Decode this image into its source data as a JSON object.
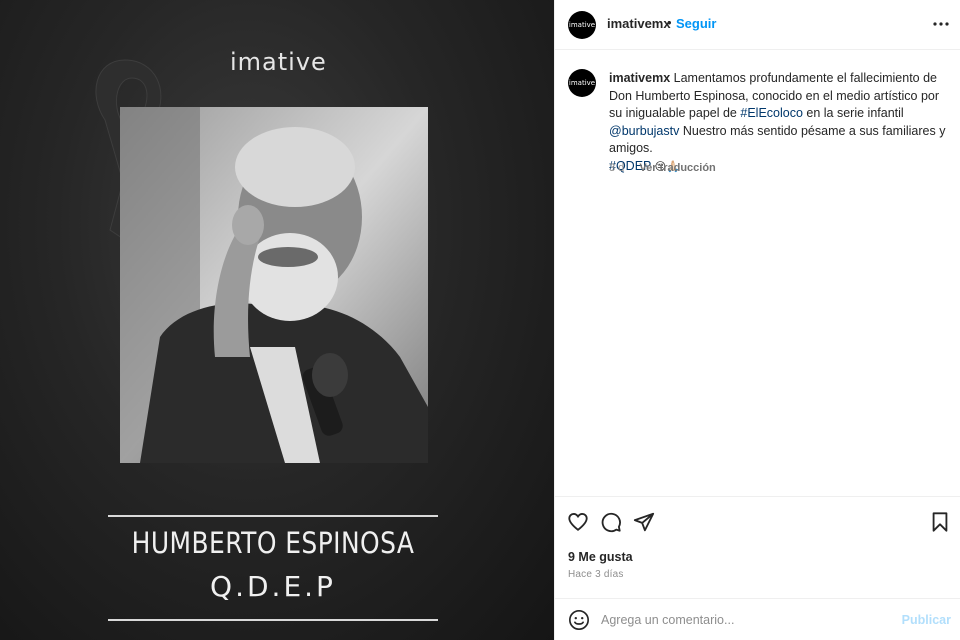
{
  "post_image": {
    "brand": "imative",
    "memorial_name": "HUMBERTO ESPINOSA",
    "memorial_rip": "Q.D.E.P"
  },
  "header": {
    "avatar_text": "imative",
    "username": "imativemx",
    "separator": "•",
    "follow_label": "Seguir",
    "more_icon": "more-horizontal-icon"
  },
  "caption": {
    "avatar_text": "imative",
    "username": "imativemx",
    "text_1": "Lamentamos profundamente el fallecimiento de Don Humberto Espinosa, conocido en el medio artístico por su inigualable papel de",
    "hashtag_1": "#ElEcoloco",
    "text_2": "en la serie infantil",
    "mention_1": "@burbujastv",
    "text_3": "Nuestro más sentido pésame a sus familiares y amigos.",
    "hashtag_2": "#QDEP",
    "emojis": "😔🙏🏻",
    "age": "3 d",
    "translate_label": "Ver traducción"
  },
  "actions": {
    "like_icon": "heart-icon",
    "comment_icon": "comment-icon",
    "share_icon": "send-icon",
    "save_icon": "bookmark-icon"
  },
  "likes": "9 Me gusta",
  "time_ago": "Hace 3 días",
  "comment": {
    "placeholder": "Agrega un comentario...",
    "post_label": "Publicar",
    "emoji_icon": "smiley-icon"
  },
  "colors": {
    "link_blue": "#0095f6",
    "hashtag": "#00376b",
    "post_disabled": "#b2dffc",
    "muted": "#8e8e8e"
  }
}
